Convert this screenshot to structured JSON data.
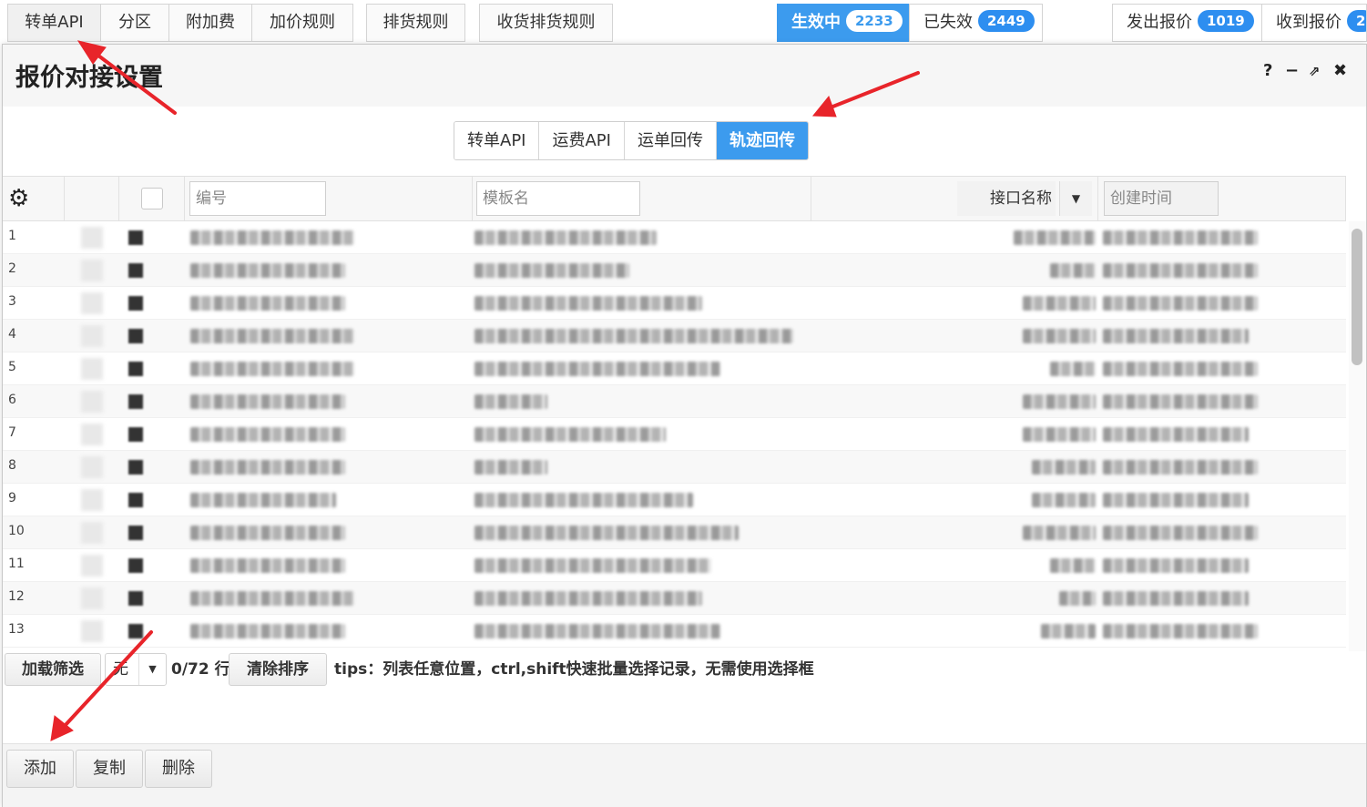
{
  "top_tabs": [
    {
      "label": "转单API"
    },
    {
      "label": "分区"
    },
    {
      "label": "附加费"
    },
    {
      "label": "加价规则"
    },
    {
      "label": "排货规则"
    },
    {
      "label": "收货排货规则"
    }
  ],
  "status_filter": {
    "active": {
      "label": "生效中",
      "count": "2233"
    },
    "expired": {
      "label": "已失效",
      "count": "2449"
    }
  },
  "quote_filter": {
    "sent": {
      "label": "发出报价",
      "count": "1019"
    },
    "received": {
      "label": "收到报价",
      "count": "2"
    }
  },
  "dialog": {
    "title": "报价对接设置",
    "help_icon": "?",
    "minimize_icon": "−",
    "popout_icon": "⇗",
    "close_icon": "✖"
  },
  "sub_tabs": [
    {
      "label": "转单API",
      "active": false
    },
    {
      "label": "运费API",
      "active": false
    },
    {
      "label": "运单回传",
      "active": false
    },
    {
      "label": "轨迹回传",
      "active": true
    }
  ],
  "grid": {
    "settings_icon": "gear-icon",
    "filter_code_placeholder": "编号",
    "filter_template_placeholder": "模板名",
    "interface_name_label": "接口名称",
    "created_time_placeholder": "创建时间",
    "row_numbers": [
      "1",
      "2",
      "3",
      "4",
      "5",
      "6",
      "7",
      "8",
      "9",
      "10",
      "11",
      "12",
      "13"
    ]
  },
  "toolbar": {
    "load_filter": "加载筛选",
    "select_value": "无",
    "row_count": "0/72 行",
    "clear_sort": "清除排序",
    "tips": "tips：列表任意位置，ctrl,shift快速批量选择记录，无需使用选择框"
  },
  "actions": {
    "add": "添加",
    "copy": "复制",
    "delete": "删除"
  },
  "colors": {
    "accent": "#3c9bee",
    "annotation_arrow": "#e8242a"
  }
}
